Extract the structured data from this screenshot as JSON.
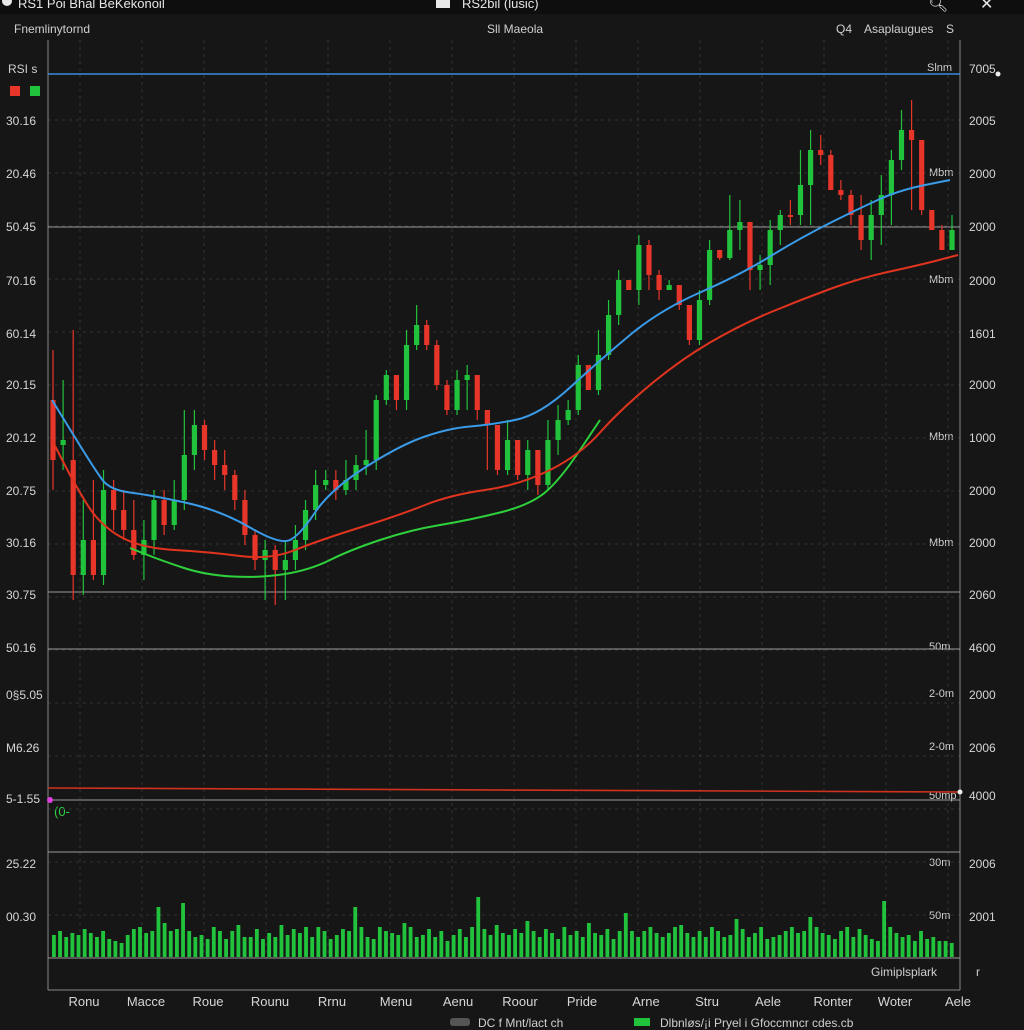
{
  "window": {
    "title": "RS1 Poi Bhal BeKekonoil",
    "center_title": "RS2bil (lusic)",
    "close_icon": "close-icon",
    "search_icon": "search-icon"
  },
  "header": {
    "left": "Fnemlinytornd",
    "center": "Sll Maeola",
    "right": "Asaplaugues",
    "right_icon_1": "Q4",
    "right_icon_2": "S"
  },
  "panel_label": "RSI s",
  "legend_colors": {
    "bear": "#e8352a",
    "bull": "#22c33c"
  },
  "left_axis": [
    "30.16",
    "20.46",
    "50.45",
    "70.16",
    "60.14",
    "20.15",
    "20.12",
    "20.75",
    "30.16",
    "30.75",
    "50.16",
    "0§5.05",
    "M6.26",
    "5-1.55",
    "25.22",
    "00.30"
  ],
  "right_axis": [
    "7005",
    "2005",
    "2000",
    "2000",
    "2000",
    "1601",
    "2000",
    "1000",
    "2000",
    "2000",
    "2060",
    "4600",
    "2000",
    "2006",
    "4000",
    "2006",
    "2001"
  ],
  "mid_labels": [
    "Slnm",
    "Mbm",
    "Mbm",
    "Mbm",
    "Mbm",
    "50m",
    "2-0m",
    "2-0m",
    "50mp",
    "30m",
    "50m"
  ],
  "marker_text": "(0-",
  "x_axis": [
    "Ronu",
    "Macce",
    "Roue",
    "Rounu",
    "Rrnu",
    "Menu",
    "Aenu",
    "Roour",
    "Pride",
    "Arne",
    "Stru",
    "Aele",
    "Ronter",
    "Woter",
    "Aele"
  ],
  "footer_right": "Gimiplsplark",
  "footer_right_icon": "r",
  "bottom_bar": [
    "DC f Mnt/lact ch",
    "Dlbnløs/¡i  Pryel  i   Gfoccmncr cdes.cb"
  ],
  "chart_data": {
    "type": "candlestick",
    "candles": [
      [
        400,
        460,
        350,
        490
      ],
      [
        445,
        440,
        380,
        470
      ],
      [
        460,
        575,
        330,
        600
      ],
      [
        575,
        540,
        500,
        595
      ],
      [
        540,
        575,
        480,
        580
      ],
      [
        575,
        490,
        470,
        585
      ],
      [
        490,
        510,
        480,
        530
      ],
      [
        510,
        530,
        490,
        540
      ],
      [
        530,
        555,
        500,
        560
      ],
      [
        555,
        540,
        520,
        580
      ],
      [
        540,
        500,
        490,
        555
      ],
      [
        500,
        525,
        490,
        535
      ],
      [
        525,
        500,
        480,
        530
      ],
      [
        500,
        455,
        410,
        510
      ],
      [
        455,
        425,
        410,
        470
      ],
      [
        425,
        450,
        420,
        460
      ],
      [
        450,
        465,
        440,
        480
      ],
      [
        465,
        475,
        450,
        490
      ],
      [
        475,
        500,
        470,
        510
      ],
      [
        500,
        535,
        490,
        545
      ],
      [
        535,
        560,
        530,
        570
      ],
      [
        560,
        550,
        540,
        600
      ],
      [
        550,
        570,
        545,
        605
      ],
      [
        570,
        560,
        540,
        600
      ],
      [
        560,
        540,
        525,
        570
      ],
      [
        540,
        510,
        500,
        550
      ],
      [
        510,
        485,
        470,
        520
      ],
      [
        485,
        480,
        470,
        490
      ],
      [
        480,
        490,
        470,
        500
      ],
      [
        490,
        480,
        460,
        495
      ],
      [
        480,
        465,
        455,
        490
      ],
      [
        465,
        460,
        430,
        475
      ],
      [
        460,
        400,
        395,
        470
      ],
      [
        400,
        375,
        370,
        405
      ],
      [
        375,
        400,
        380,
        410
      ],
      [
        400,
        345,
        330,
        410
      ],
      [
        345,
        325,
        305,
        350
      ],
      [
        325,
        345,
        320,
        350
      ],
      [
        345,
        385,
        340,
        390
      ],
      [
        385,
        410,
        380,
        415
      ],
      [
        410,
        380,
        370,
        415
      ],
      [
        380,
        375,
        365,
        410
      ],
      [
        375,
        410,
        395,
        420
      ],
      [
        410,
        425,
        420,
        470
      ],
      [
        425,
        470,
        460,
        475
      ],
      [
        470,
        440,
        420,
        475
      ],
      [
        440,
        475,
        450,
        480
      ],
      [
        475,
        450,
        440,
        490
      ],
      [
        450,
        485,
        460,
        495
      ],
      [
        485,
        440,
        420,
        490
      ],
      [
        440,
        420,
        405,
        455
      ],
      [
        420,
        410,
        400,
        425
      ],
      [
        410,
        365,
        355,
        415
      ],
      [
        365,
        390,
        380,
        390
      ],
      [
        390,
        355,
        330,
        395
      ],
      [
        355,
        315,
        300,
        360
      ],
      [
        315,
        280,
        270,
        325
      ],
      [
        280,
        290,
        280,
        290
      ],
      [
        290,
        245,
        235,
        305
      ],
      [
        245,
        275,
        240,
        290
      ],
      [
        275,
        290,
        270,
        300
      ],
      [
        290,
        285,
        280,
        290
      ],
      [
        285,
        305,
        290,
        310
      ],
      [
        305,
        340,
        335,
        345
      ],
      [
        340,
        300,
        290,
        345
      ],
      [
        300,
        250,
        240,
        305
      ],
      [
        250,
        258,
        250,
        260
      ],
      [
        258,
        230,
        195,
        260
      ],
      [
        230,
        222,
        200,
        250
      ],
      [
        222,
        270,
        230,
        290
      ],
      [
        270,
        265,
        255,
        290
      ],
      [
        265,
        230,
        220,
        285
      ],
      [
        230,
        215,
        210,
        245
      ],
      [
        215,
        215,
        200,
        225
      ],
      [
        215,
        185,
        150,
        225
      ],
      [
        185,
        150,
        130,
        225
      ],
      [
        150,
        155,
        135,
        165
      ],
      [
        155,
        190,
        150,
        190
      ],
      [
        190,
        195,
        180,
        200
      ],
      [
        195,
        215,
        190,
        225
      ],
      [
        215,
        240,
        195,
        250
      ],
      [
        240,
        215,
        200,
        260
      ],
      [
        215,
        195,
        175,
        245
      ],
      [
        195,
        160,
        150,
        225
      ],
      [
        160,
        130,
        110,
        170
      ],
      [
        130,
        140,
        100,
        210
      ],
      [
        140,
        210,
        210,
        215
      ],
      [
        210,
        230,
        210,
        230
      ],
      [
        230,
        250,
        225,
        250
      ],
      [
        250,
        230,
        215,
        250
      ]
    ],
    "ma_blue": [
      [
        52,
        400
      ],
      [
        95,
        470
      ],
      [
        110,
        490
      ],
      [
        150,
        495
      ],
      [
        220,
        510
      ],
      [
        280,
        545
      ],
      [
        300,
        535
      ],
      [
        330,
        490
      ],
      [
        400,
        445
      ],
      [
        450,
        428
      ],
      [
        490,
        425
      ],
      [
        540,
        415
      ],
      [
        600,
        360
      ],
      [
        660,
        310
      ],
      [
        740,
        275
      ],
      [
        800,
        238
      ],
      [
        860,
        208
      ],
      [
        900,
        190
      ],
      [
        950,
        180
      ]
    ],
    "ma_red": [
      [
        52,
        440
      ],
      [
        75,
        485
      ],
      [
        100,
        525
      ],
      [
        140,
        548
      ],
      [
        210,
        552
      ],
      [
        270,
        560
      ],
      [
        320,
        540
      ],
      [
        400,
        515
      ],
      [
        450,
        495
      ],
      [
        520,
        485
      ],
      [
        580,
        455
      ],
      [
        620,
        410
      ],
      [
        680,
        360
      ],
      [
        740,
        325
      ],
      [
        800,
        300
      ],
      [
        860,
        278
      ],
      [
        920,
        265
      ],
      [
        958,
        255
      ]
    ],
    "ma_green": [
      [
        130,
        548
      ],
      [
        160,
        560
      ],
      [
        205,
        575
      ],
      [
        260,
        578
      ],
      [
        310,
        570
      ],
      [
        350,
        550
      ],
      [
        410,
        530
      ],
      [
        470,
        520
      ],
      [
        530,
        505
      ],
      [
        560,
        480
      ],
      [
        600,
        420
      ]
    ],
    "lower_line": {
      "color": "#d0321f",
      "values": [
        788,
        792
      ]
    },
    "volume": [
      22,
      26,
      20,
      24,
      22,
      28,
      24,
      20,
      26,
      18,
      16,
      14,
      22,
      28,
      30,
      24,
      26,
      50,
      34,
      26,
      28,
      54,
      26,
      20,
      22,
      18,
      30,
      26,
      18,
      26,
      32,
      20,
      20,
      28,
      18,
      24,
      20,
      32,
      22,
      28,
      24,
      30,
      20,
      30,
      26,
      18,
      22,
      28,
      26,
      50,
      30,
      20,
      18,
      30,
      26,
      24,
      22,
      34,
      30,
      20,
      22,
      28,
      20,
      26,
      16,
      22,
      28,
      20,
      30,
      60,
      28,
      22,
      32,
      24,
      22,
      28,
      24,
      36,
      26,
      20,
      28,
      24,
      18,
      30,
      22,
      26,
      20,
      34,
      24,
      22,
      28,
      18,
      26,
      44,
      26,
      20,
      26,
      30,
      24,
      20,
      24,
      30,
      32,
      24,
      20,
      26,
      20,
      30,
      26,
      20,
      22,
      38,
      28,
      20,
      24,
      30,
      18,
      20,
      22,
      26,
      30,
      24,
      26,
      40,
      30,
      24,
      22,
      18,
      26,
      30,
      20,
      28,
      22,
      18,
      16,
      56,
      30,
      24,
      20,
      22,
      16,
      26,
      18,
      20,
      16,
      16,
      14
    ],
    "x_labels": [
      "Ronu",
      "Macce",
      "Roue",
      "Rounu",
      "Rrnu",
      "Menu",
      "Aenu",
      "Roour",
      "Pride",
      "Arne",
      "Stru",
      "Aele",
      "Ronter",
      "Woter",
      "Aele"
    ]
  }
}
